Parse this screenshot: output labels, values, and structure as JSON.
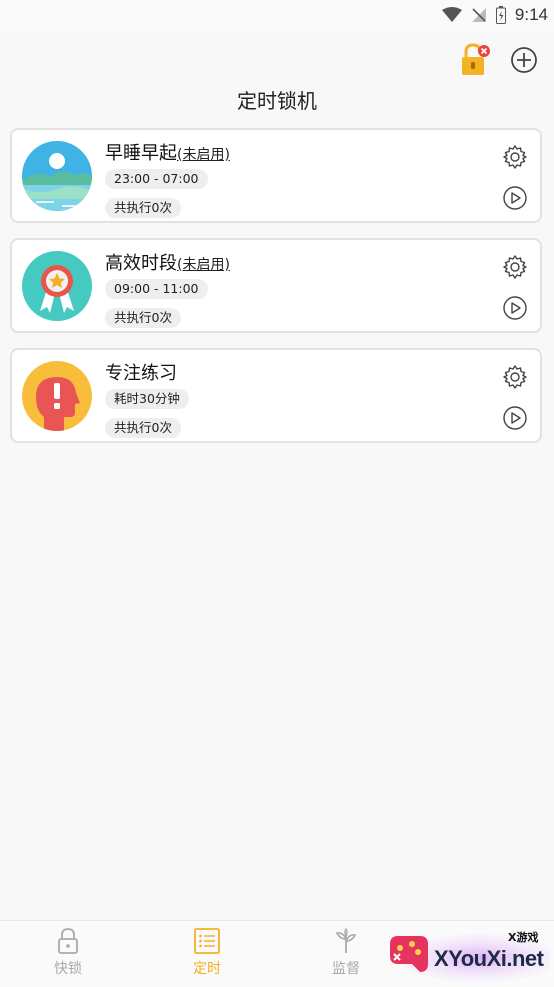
{
  "status_bar": {
    "time": "9:14"
  },
  "header": {
    "title": "定时锁机"
  },
  "cards": [
    {
      "name": "早睡早起",
      "state": "(未启用)",
      "time_range": "23:00 - 07:00",
      "run_count": "共执行0次",
      "avatar_icon": "sunrise-lake-icon"
    },
    {
      "name": "高效时段",
      "state": "(未启用)",
      "time_range": "09:00 - 11:00",
      "run_count": "共执行0次",
      "avatar_icon": "ribbon-medal-icon"
    },
    {
      "name": "专注练习",
      "state": "",
      "time_range": "耗时30分钟",
      "run_count": "共执行0次",
      "avatar_icon": "head-alert-icon"
    }
  ],
  "bottom_nav": [
    {
      "label": "快锁",
      "icon": "padlock-icon",
      "active": false
    },
    {
      "label": "定时",
      "icon": "schedule-list-icon",
      "active": true
    },
    {
      "label": "监督",
      "icon": "sprout-icon",
      "active": false
    }
  ],
  "colors": {
    "accent": "#f3b024",
    "inactive": "#aaaaaa"
  },
  "watermark": {
    "brand": "XYouXi.net",
    "tag": "X游戏"
  }
}
